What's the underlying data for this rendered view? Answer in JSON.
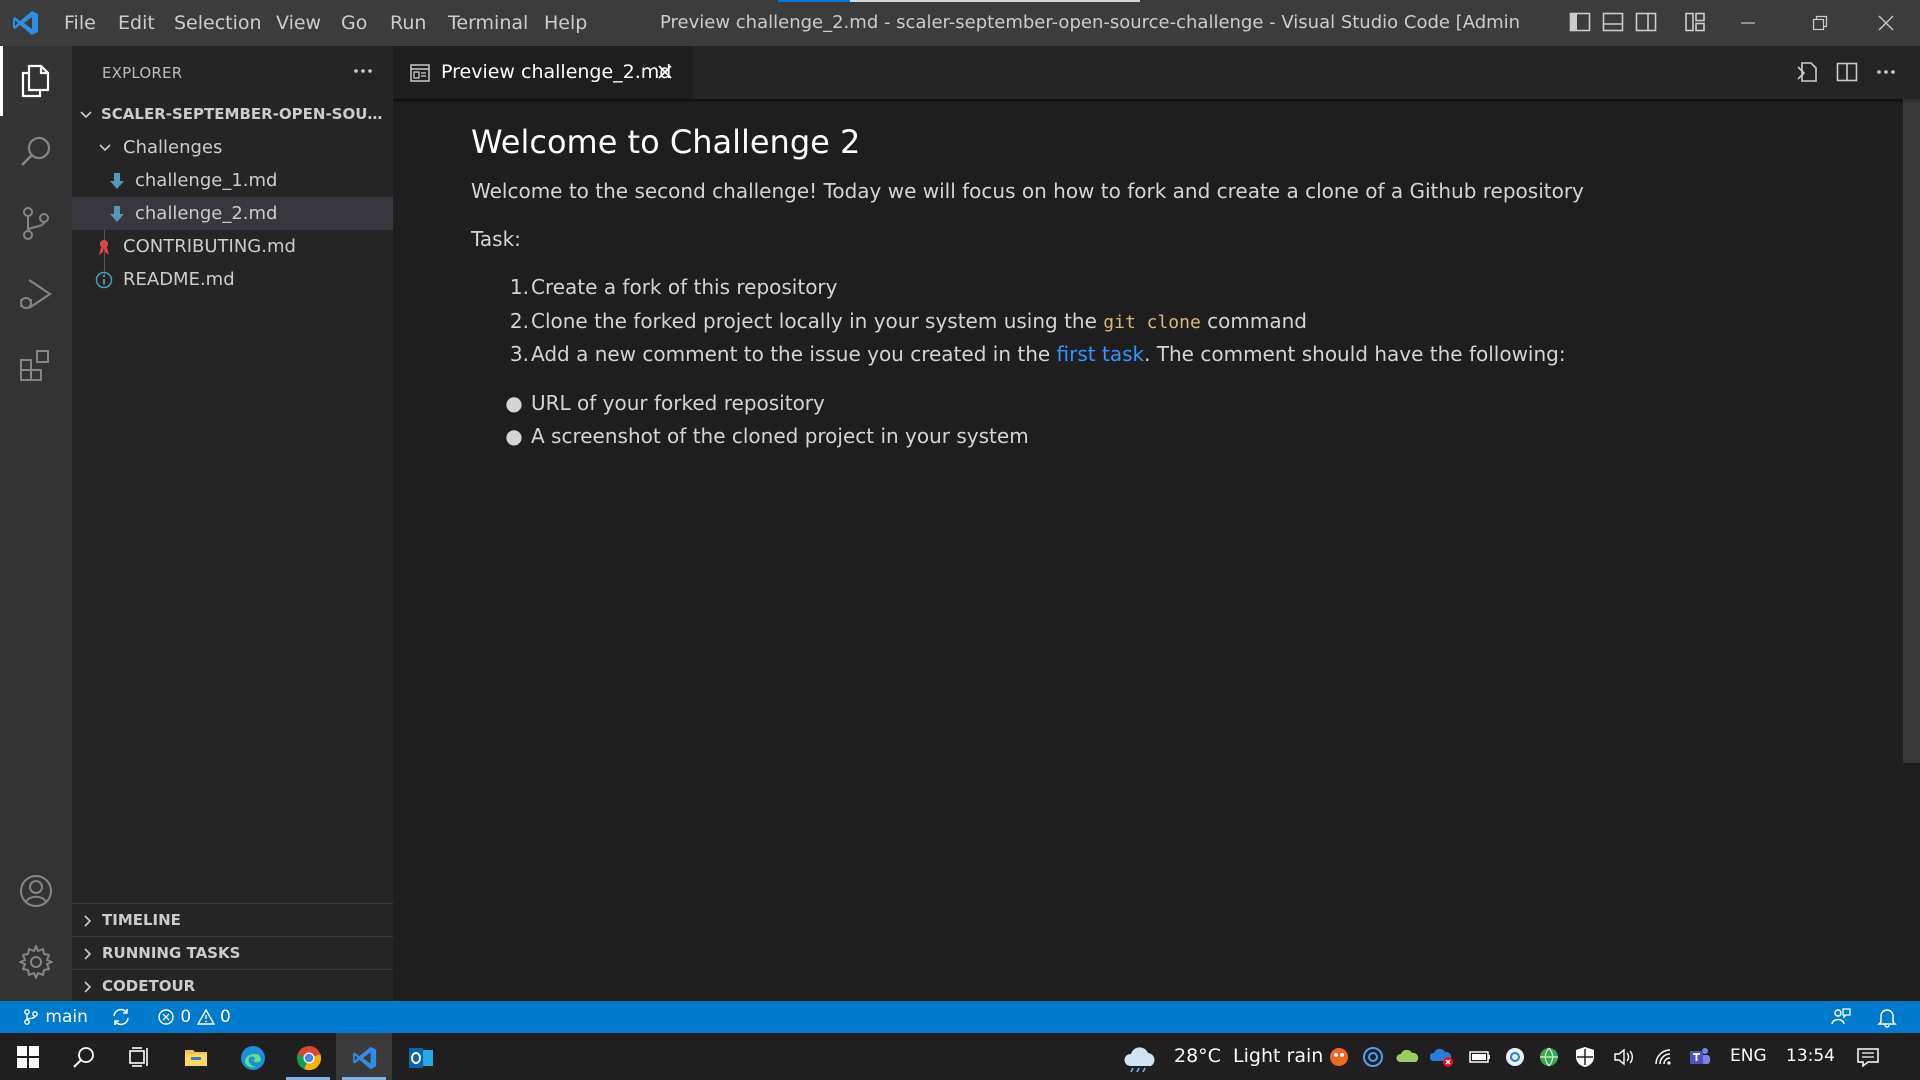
{
  "titlebar": {
    "menu": [
      "File",
      "Edit",
      "Selection",
      "View",
      "Go",
      "Run",
      "Terminal",
      "Help"
    ],
    "window_title": "Preview challenge_2.md - scaler-september-open-source-challenge - Visual Studio Code [Administrator]"
  },
  "sidebar": {
    "title": "EXPLORER",
    "root_folder": "SCALER-SEPTEMBER-OPEN-SOURCE-CHALLENGE",
    "tree": [
      {
        "label": "Challenges",
        "kind": "folder",
        "expanded": true
      },
      {
        "label": "challenge_1.md",
        "kind": "markdown",
        "selected": false
      },
      {
        "label": "challenge_2.md",
        "kind": "markdown",
        "selected": true
      },
      {
        "label": "CONTRIBUTING.md",
        "kind": "contributing"
      },
      {
        "label": "README.md",
        "kind": "readme"
      }
    ],
    "sections": [
      "TIMELINE",
      "RUNNING TASKS",
      "CODETOUR"
    ]
  },
  "tab": {
    "label": "Preview challenge_2.md"
  },
  "preview": {
    "heading": "Welcome to Challenge 2",
    "intro": "Welcome to the second challenge! Today we will focus on how to fork and create a clone of a Github repository",
    "task_label": "Task:",
    "ordered": {
      "markers": [
        "1.",
        "2.",
        "3."
      ],
      "item1": "Create a fork of this repository",
      "item2_pre": "Clone the forked project locally in your system using the ",
      "item2_code": "git clone",
      "item2_post": " command",
      "item3_pre": "Add a new comment to the issue you created in the ",
      "item3_link": "first task",
      "item3_post": ". The comment should have the following:"
    },
    "bullets": [
      "URL of your forked repository",
      "A screenshot of the cloned project in your system"
    ]
  },
  "statusbar": {
    "branch": "main",
    "errors": "0",
    "warnings": "0"
  },
  "taskbar": {
    "weather_temp": "28°C",
    "weather_text": "Light rain",
    "language": "ENG",
    "time": "13:54"
  },
  "colors": {
    "accent": "#007acc",
    "link": "#3794ff",
    "code": "#d7ba7d",
    "editor_bg": "#1e1e1e",
    "sidebar_bg": "#252526"
  },
  "icons": {
    "activity": [
      "explorer-icon",
      "search-icon",
      "source-control-icon",
      "run-debug-icon",
      "extensions-icon",
      "account-icon",
      "settings-gear-icon"
    ]
  }
}
